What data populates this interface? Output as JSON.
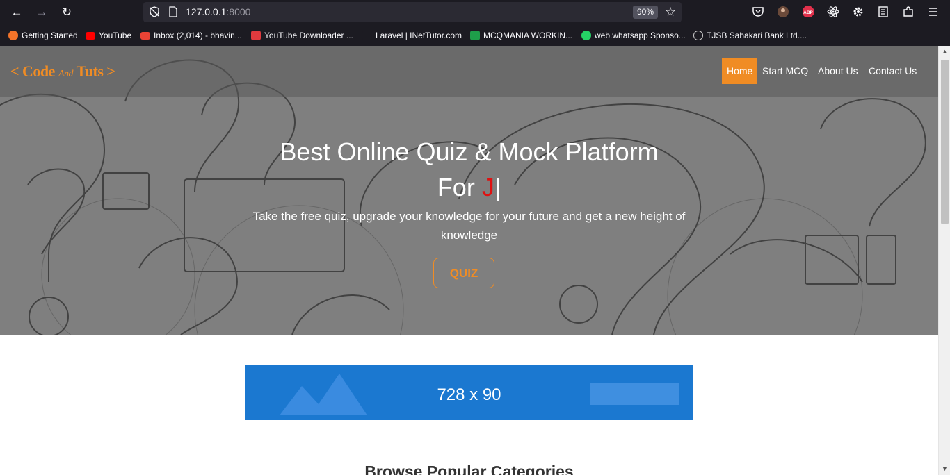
{
  "browser": {
    "url_host": "127.0.0.1",
    "url_port": ":8000",
    "zoom": "90%"
  },
  "bookmarks": [
    {
      "label": "Getting Started",
      "icon": "firefox-icon",
      "color": "#f27329"
    },
    {
      "label": "YouTube",
      "icon": "youtube-icon",
      "color": "#ff0000"
    },
    {
      "label": "Inbox (2,014) - bhavin...",
      "icon": "gmail-icon",
      "color": "#ea4335"
    },
    {
      "label": "YouTube Downloader ...",
      "icon": "download-icon",
      "color": "#e03a3e"
    },
    {
      "label": "Laravel | INetTutor.com",
      "icon": "blank-icon",
      "color": "#1c1b22"
    },
    {
      "label": "MCQMANIA WORKIN...",
      "icon": "cross-icon",
      "color": "#1e9e4a"
    },
    {
      "label": "web.whatsapp Sponso...",
      "icon": "whatsapp-icon",
      "color": "#25d366"
    },
    {
      "label": "TJSB Sahakari Bank Ltd....",
      "icon": "globe-icon",
      "color": "#cccccc"
    }
  ],
  "site": {
    "logo_code": "< Code",
    "logo_and": "And",
    "logo_tuts": "Tuts >",
    "nav": {
      "home": "Home",
      "start_mcq": "Start MCQ",
      "about": "About Us",
      "contact": "Contact Us"
    },
    "accent_color": "#f08c24"
  },
  "hero": {
    "title": "Best Online Quiz & Mock Platform",
    "typed_prefix": "For ",
    "typed_letter": "J",
    "typed_cursor": "|",
    "subtitle": "Take the free quiz, upgrade your knowledge for your future and get a new height of knowledge",
    "button": "QUIZ"
  },
  "ad": {
    "label": "728 x 90"
  },
  "categories": {
    "heading": "Browse Popular Categories"
  }
}
